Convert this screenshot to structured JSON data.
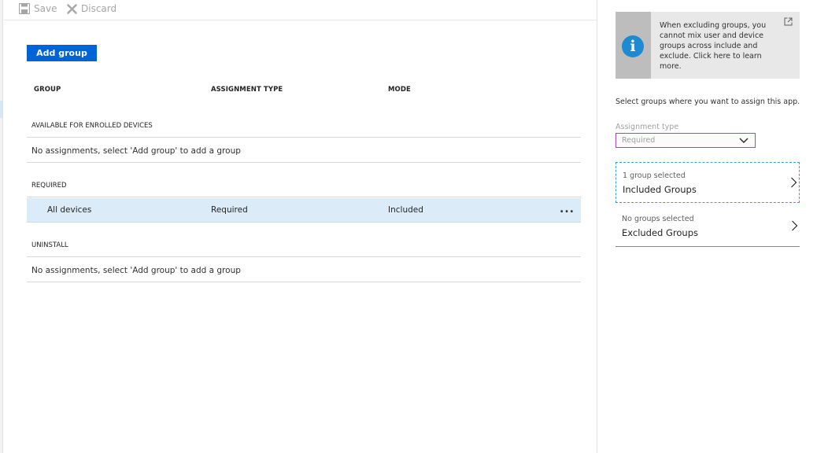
{
  "toolbar": {
    "save_label": "Save",
    "discard_label": "Discard"
  },
  "main": {
    "add_group_label": "Add group",
    "columns": [
      "GROUP",
      "ASSIGNMENT TYPE",
      "MODE"
    ],
    "sections": [
      {
        "title": "AVAILABLE FOR ENROLLED DEVICES",
        "empty_text": "No assignments, select 'Add group' to add a group"
      },
      {
        "title": "REQUIRED",
        "rows": [
          {
            "group": "All devices",
            "assignment_type": "Required",
            "mode": "Included",
            "more": "..."
          }
        ]
      },
      {
        "title": "UNINSTALL",
        "empty_text": "No assignments, select 'Add group' to add a group"
      }
    ]
  },
  "side": {
    "info": {
      "text": "When excluding groups, you cannot mix user and device groups across include and exclude.  Click here to learn more.",
      "icon": "info-icon",
      "link_icon": "open-external-icon"
    },
    "description": "Select groups where you want to assign this app.",
    "assignment_type_label": "Assignment type",
    "assignment_type_value": "Required",
    "included": {
      "sub": "1 group selected",
      "title": "Included Groups"
    },
    "excluded": {
      "sub": "No groups selected",
      "title": "Excluded Groups"
    }
  },
  "colors": {
    "accent": "#0063d6",
    "selected_row": "#dcebf8",
    "info_icon": "#1d8ad1",
    "select_border": "#a24bb7"
  }
}
